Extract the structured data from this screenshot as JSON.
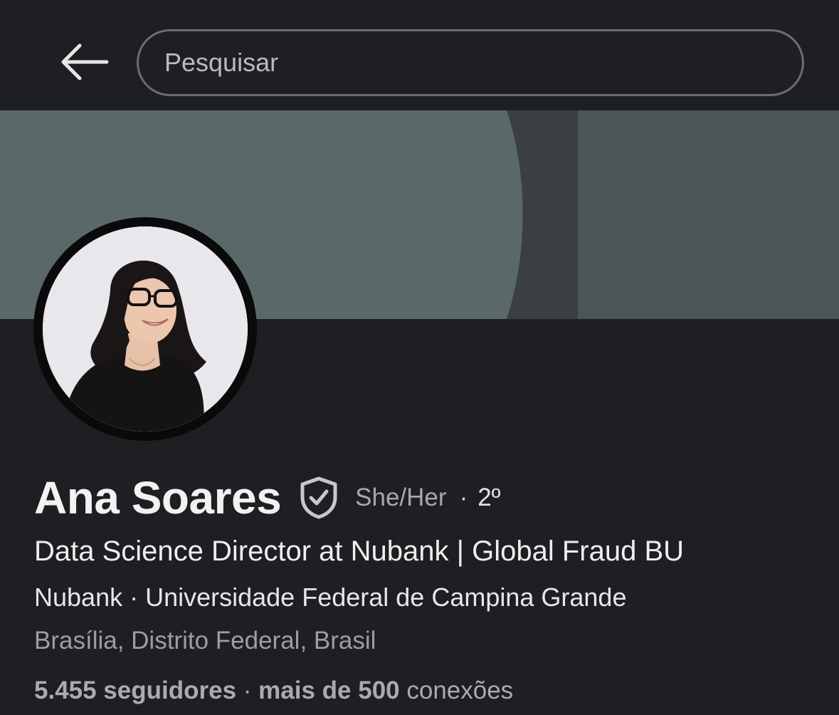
{
  "search": {
    "placeholder": "Pesquisar"
  },
  "profile": {
    "name": "Ana Soares",
    "pronouns": "She/Her",
    "separator": "·",
    "degree": "2º",
    "headline": "Data Science Director at Nubank | Global Fraud BU",
    "company": "Nubank",
    "org_separator": " · ",
    "education": "Universidade Federal de Campina Grande",
    "location": "Brasília, Distrito Federal, Brasil",
    "followers_count": "5.455 seguidores",
    "stats_separator": " · ",
    "connections_count": "mais de 500",
    "connections_label": " conexões"
  },
  "icons": {
    "back": "arrow-left-icon",
    "verified": "shield-check-icon"
  }
}
